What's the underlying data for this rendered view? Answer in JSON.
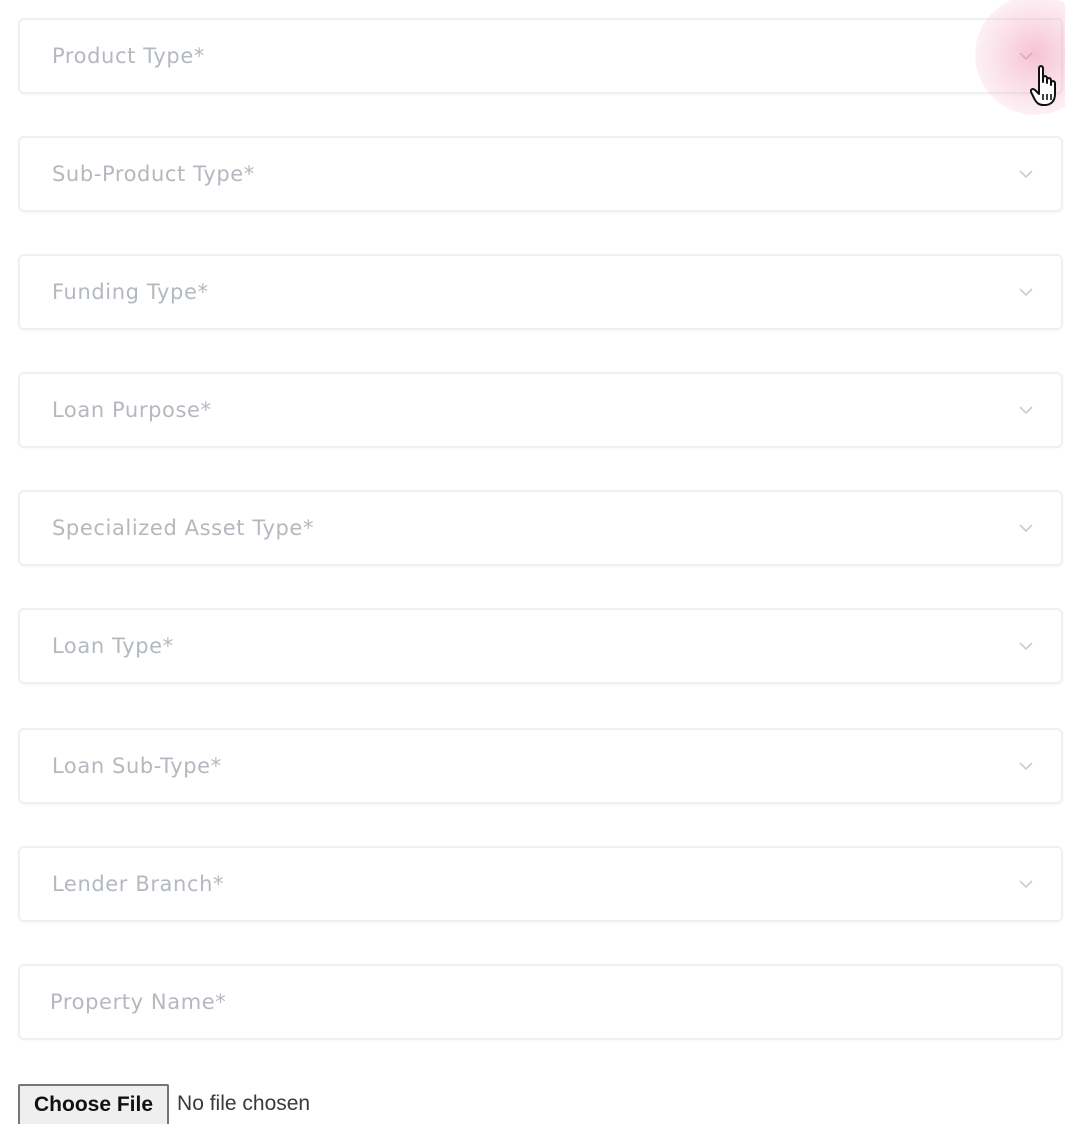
{
  "form": {
    "fields": [
      {
        "label": "Product Type*",
        "kind": "select",
        "icon": "chevron-down-icon"
      },
      {
        "label": "Sub-Product Type*",
        "kind": "select",
        "icon": "chevron-down-icon"
      },
      {
        "label": "Funding Type*",
        "kind": "select",
        "icon": "chevron-down-icon"
      },
      {
        "label": "Loan Purpose*",
        "kind": "select",
        "icon": "chevron-down-icon"
      },
      {
        "label": "Specialized Asset Type*",
        "kind": "select",
        "icon": "chevron-down-icon"
      },
      {
        "label": "Loan Type*",
        "kind": "select",
        "icon": "chevron-down-icon"
      },
      {
        "label": "Loan Sub-Type*",
        "kind": "select",
        "icon": "chevron-down-icon"
      },
      {
        "label": "Lender Branch*",
        "kind": "select",
        "icon": "chevron-down-icon"
      },
      {
        "label": "Property Name*",
        "kind": "text"
      }
    ],
    "file_input": {
      "button_label": "Choose File",
      "status_text": "No file chosen"
    }
  },
  "cursor": {
    "icon": "hand-pointer-icon",
    "highlight_color": "#f4aac4"
  },
  "colors": {
    "placeholder": "#b4b8bf",
    "field_border": "#eef0f3"
  }
}
